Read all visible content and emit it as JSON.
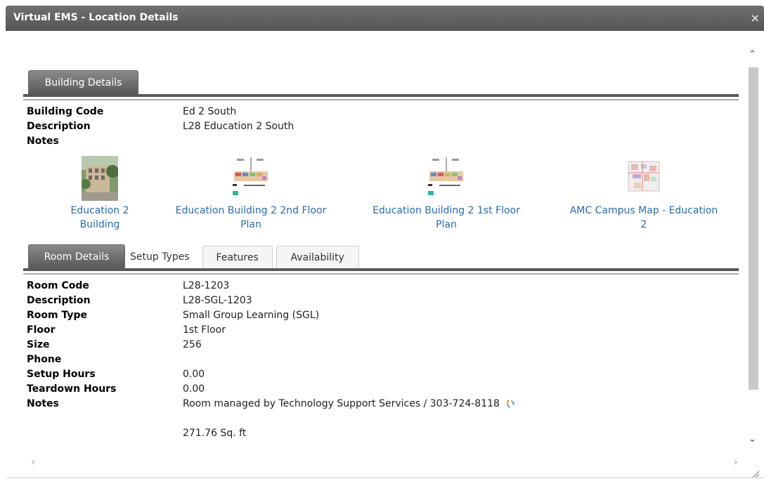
{
  "window": {
    "title": "Virtual EMS - Location Details",
    "close_glyph": "×"
  },
  "building": {
    "tab_label": "Building Details",
    "fields": [
      {
        "label": "Building Code",
        "value": "Ed 2 South"
      },
      {
        "label": "Description",
        "value": "L28 Education 2 South"
      },
      {
        "label": "Notes",
        "value": ""
      }
    ],
    "images": [
      {
        "caption_line1": "Education 2",
        "caption_line2": "Building",
        "icon": "building-photo-icon"
      },
      {
        "caption_line1": "Education Building 2 2nd Floor",
        "caption_line2": "Plan",
        "icon": "floor-plan-icon"
      },
      {
        "caption_line1": "Education Building 2 1st Floor",
        "caption_line2": "Plan",
        "icon": "floor-plan-icon"
      },
      {
        "caption_line1": "AMC Campus Map - Education",
        "caption_line2": "2",
        "icon": "campus-map-icon"
      }
    ]
  },
  "room": {
    "tabs": [
      "Room Details",
      "Setup Types",
      "Features",
      "Availability"
    ],
    "active_tab": "Room Details",
    "fields": [
      {
        "label": "Room Code",
        "value": "L28-1203"
      },
      {
        "label": "Description",
        "value": "L28-SGL-1203"
      },
      {
        "label": "Room Type",
        "value": "Small Group Learning (SGL)"
      },
      {
        "label": "Floor",
        "value": "1st Floor"
      },
      {
        "label": "Size",
        "value": "256"
      },
      {
        "label": "Phone",
        "value": ""
      },
      {
        "label": "Setup Hours",
        "value": "0.00"
      },
      {
        "label": "Teardown Hours",
        "value": "0.00"
      },
      {
        "label": "Notes",
        "value": "Room managed by Technology Support Services / 303-724-8118"
      }
    ],
    "notes_extra": "271.76 Sq. ft"
  },
  "colors": {
    "titlebar": "#5e5e5e",
    "link": "#2a6ab1",
    "active_tab": "#6e6e6e"
  }
}
